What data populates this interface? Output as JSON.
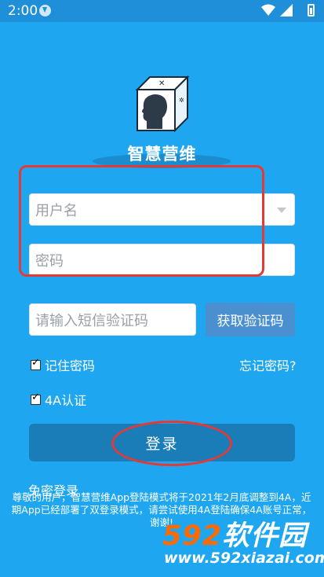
{
  "status_bar": {
    "time": "2:00"
  },
  "app": {
    "title": "智慧营维"
  },
  "form": {
    "username_placeholder": "用户名",
    "password_placeholder": "密码",
    "sms_placeholder": "请输入短信验证码",
    "get_code_label": "获取验证码",
    "remember_label": "记住密码",
    "forgot_label": "忘记密码?",
    "auth_label": "4A认证",
    "login_label": "登录",
    "passwordless_label": "免密登录"
  },
  "notice": "尊敬的用户，智慧营维App登陆模式将于2021年2月底调整到4A，近期App已经部署了双登录模式，请尝试使用4A登陆确保4A账号正常，谢谢!",
  "watermark": {
    "brand_digits": "592",
    "brand_text": "软件园",
    "url": "www.592xiazai.com"
  },
  "colors": {
    "background": "#1ea6f0",
    "button": "#1a7db7",
    "annotation": "#e53935",
    "watermark": "#ff6a00"
  }
}
